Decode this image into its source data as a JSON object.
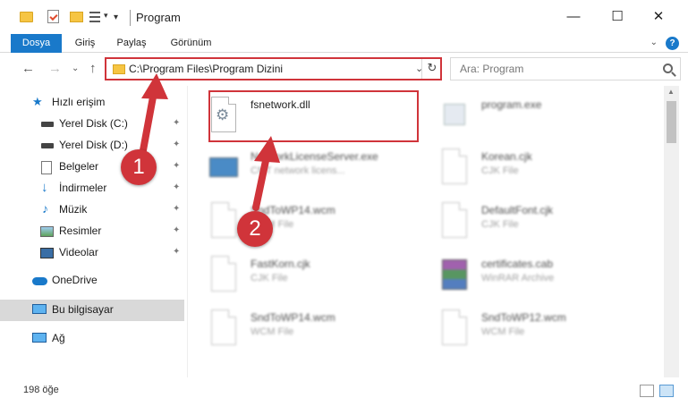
{
  "window": {
    "title": "Program",
    "minimize_glyph": "—",
    "maximize_glyph": "☐",
    "close_glyph": "✕"
  },
  "ribbon": {
    "tabs": [
      {
        "label": "Dosya",
        "active": true
      },
      {
        "label": "Giriş"
      },
      {
        "label": "Paylaş"
      },
      {
        "label": "Görünüm"
      }
    ],
    "help_glyph": "?",
    "expand_glyph": "⌄"
  },
  "nav": {
    "back_glyph": "←",
    "forward_glyph": "→",
    "recent_glyph": "⌄",
    "up_glyph": "↑"
  },
  "address": {
    "path": "C:\\Program Files\\Program Dizini",
    "dropdown_glyph": "⌄",
    "refresh_glyph": "↻"
  },
  "search": {
    "placeholder": "Ara: Program"
  },
  "sidebar": {
    "items": [
      {
        "label": "Hızlı erişim",
        "icon": "star-icon",
        "pinned": false
      },
      {
        "label": "Yerel Disk (C:)",
        "icon": "drive-icon",
        "pinned": true
      },
      {
        "label": "Yerel Disk (D:)",
        "icon": "drive-icon",
        "pinned": true
      },
      {
        "label": "Belgeler",
        "icon": "documents-icon",
        "pinned": true
      },
      {
        "label": "İndirmeler",
        "icon": "download-icon",
        "pinned": true
      },
      {
        "label": "Müzik",
        "icon": "music-icon",
        "pinned": true
      },
      {
        "label": "Resimler",
        "icon": "pictures-icon",
        "pinned": true
      },
      {
        "label": "Videolar",
        "icon": "videos-icon",
        "pinned": true
      },
      {
        "label": "OneDrive",
        "icon": "cloud-icon",
        "pinned": false
      },
      {
        "label": "Bu bilgisayar",
        "icon": "computer-icon",
        "pinned": false,
        "selected": true
      },
      {
        "label": "Ağ",
        "icon": "network-icon",
        "pinned": false
      }
    ],
    "pin_glyph": "📌"
  },
  "files": [
    {
      "name": "fsnetwork.dll",
      "type": "",
      "icon": "dll-icon"
    },
    {
      "name": "program.exe",
      "type": "",
      "icon": "exe-icon"
    },
    {
      "name": "NetworkLicenseServer.exe",
      "type": "CMT network licens...",
      "icon": "exe-icon"
    },
    {
      "name": "Korean.cjk",
      "type": "CJK File",
      "icon": "file-icon"
    },
    {
      "name": "SndToWP14.wcm",
      "type": "WCM File",
      "icon": "file-icon"
    },
    {
      "name": "DefaultFont.cjk",
      "type": "CJK File",
      "icon": "file-icon"
    },
    {
      "name": "FastKorn.cjk",
      "type": "CJK File",
      "icon": "file-icon"
    },
    {
      "name": "certificates.cab",
      "type": "WinRAR Archive",
      "icon": "archive-icon"
    },
    {
      "name": "SndToWP14.wcm",
      "type": "WCM File",
      "icon": "file-icon"
    },
    {
      "name": "SndToWP12.wcm",
      "type": "WCM File",
      "icon": "file-icon"
    }
  ],
  "callouts": {
    "one": "1",
    "two": "2"
  },
  "status": {
    "count": "198 öğe"
  },
  "colors": {
    "accent": "#1979ca",
    "callout": "#d0343a",
    "folder": "#f6c543",
    "selected_nav": "#d9d9d9"
  }
}
